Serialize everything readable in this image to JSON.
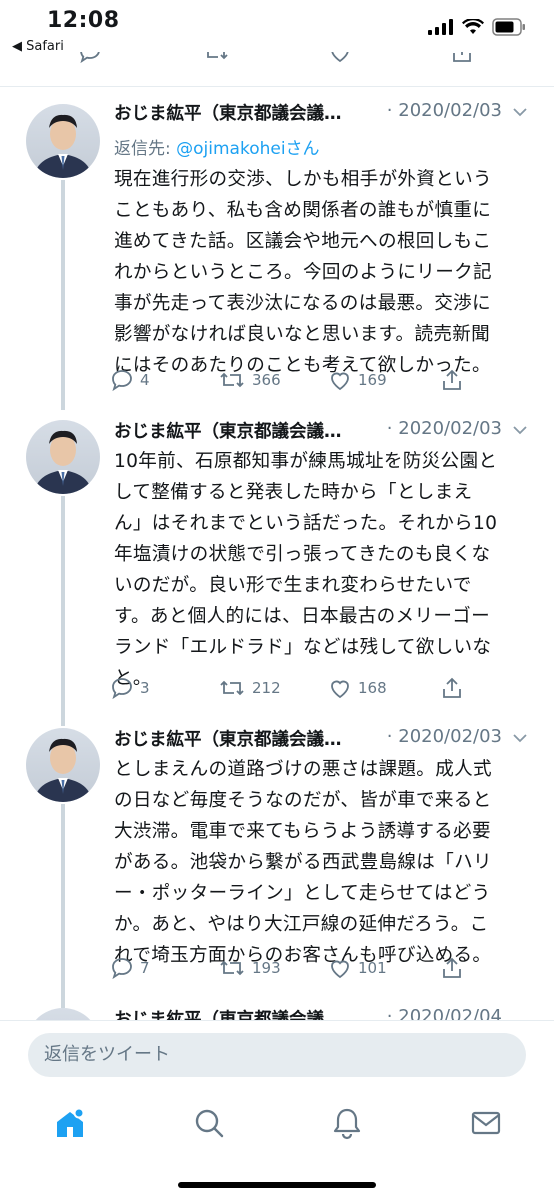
{
  "status": {
    "time": "12:08",
    "back_app": "◀ Safari"
  },
  "tweets": [
    {
      "name": "おじま紘平（東京都議会議…",
      "date": "· 2020/02/03",
      "reply_prefix": "返信先: ",
      "reply_handle": "@ojimakoheiさん",
      "text": "現在進行形の交渉、しかも相手が外資という\nこともあり、私も含め関係者の誰もが慎重に\n進めてきた話。区議会や地元への根回しもこ\nれからというところ。今回のようにリーク記\n事が先走って表沙汰になるのは最悪。交渉に\n影響がなければ良いなと思います。読売新聞\nにはそのあたりのことも考えて欲しかった。",
      "replies": "4",
      "retweets": "366",
      "likes": "169"
    },
    {
      "name": "おじま紘平（東京都議会議…",
      "date": "· 2020/02/03",
      "text": "10年前、石原都知事が練馬城址を防災公園と\nして整備すると発表した時から「としまえ\nん」はそれまでという話だった。それから10\n年塩漬けの状態で引っ張ってきたのも良くな\nいのだが。良い形で生まれ変わらせたいで\nす。あと個人的には、日本最古のメリーゴー\nランド「エルドラド」などは残して欲しいな\nと。",
      "replies": "3",
      "retweets": "212",
      "likes": "168"
    },
    {
      "name": "おじま紘平（東京都議会議…",
      "date": "· 2020/02/03",
      "text": "としまえんの道路づけの悪さは課題。成人式\nの日など毎度そうなのだが、皆が車で来ると\n大渋滞。電車で来てもらうよう誘導する必要\nがある。池袋から繋がる西武豊島線は「ハリ\nー・ポッターライン」として走らせてはどう\nか。あと、やはり大江戸線の延伸だろう。こ\nれで埼玉方面からのお客さんも呼び込める。",
      "replies": "7",
      "retweets": "193",
      "likes": "101"
    },
    {
      "name": "おじま紘平（東京都議会議…",
      "date": "· 2020/02/04"
    }
  ],
  "reply_placeholder": "返信をツイート",
  "icons": {
    "home": "home-icon",
    "search": "search-icon",
    "notifications": "bell-icon",
    "messages": "mail-icon"
  },
  "colors": {
    "accent": "#1da1f2",
    "muted": "#657786",
    "divider": "#e6ecf0"
  }
}
